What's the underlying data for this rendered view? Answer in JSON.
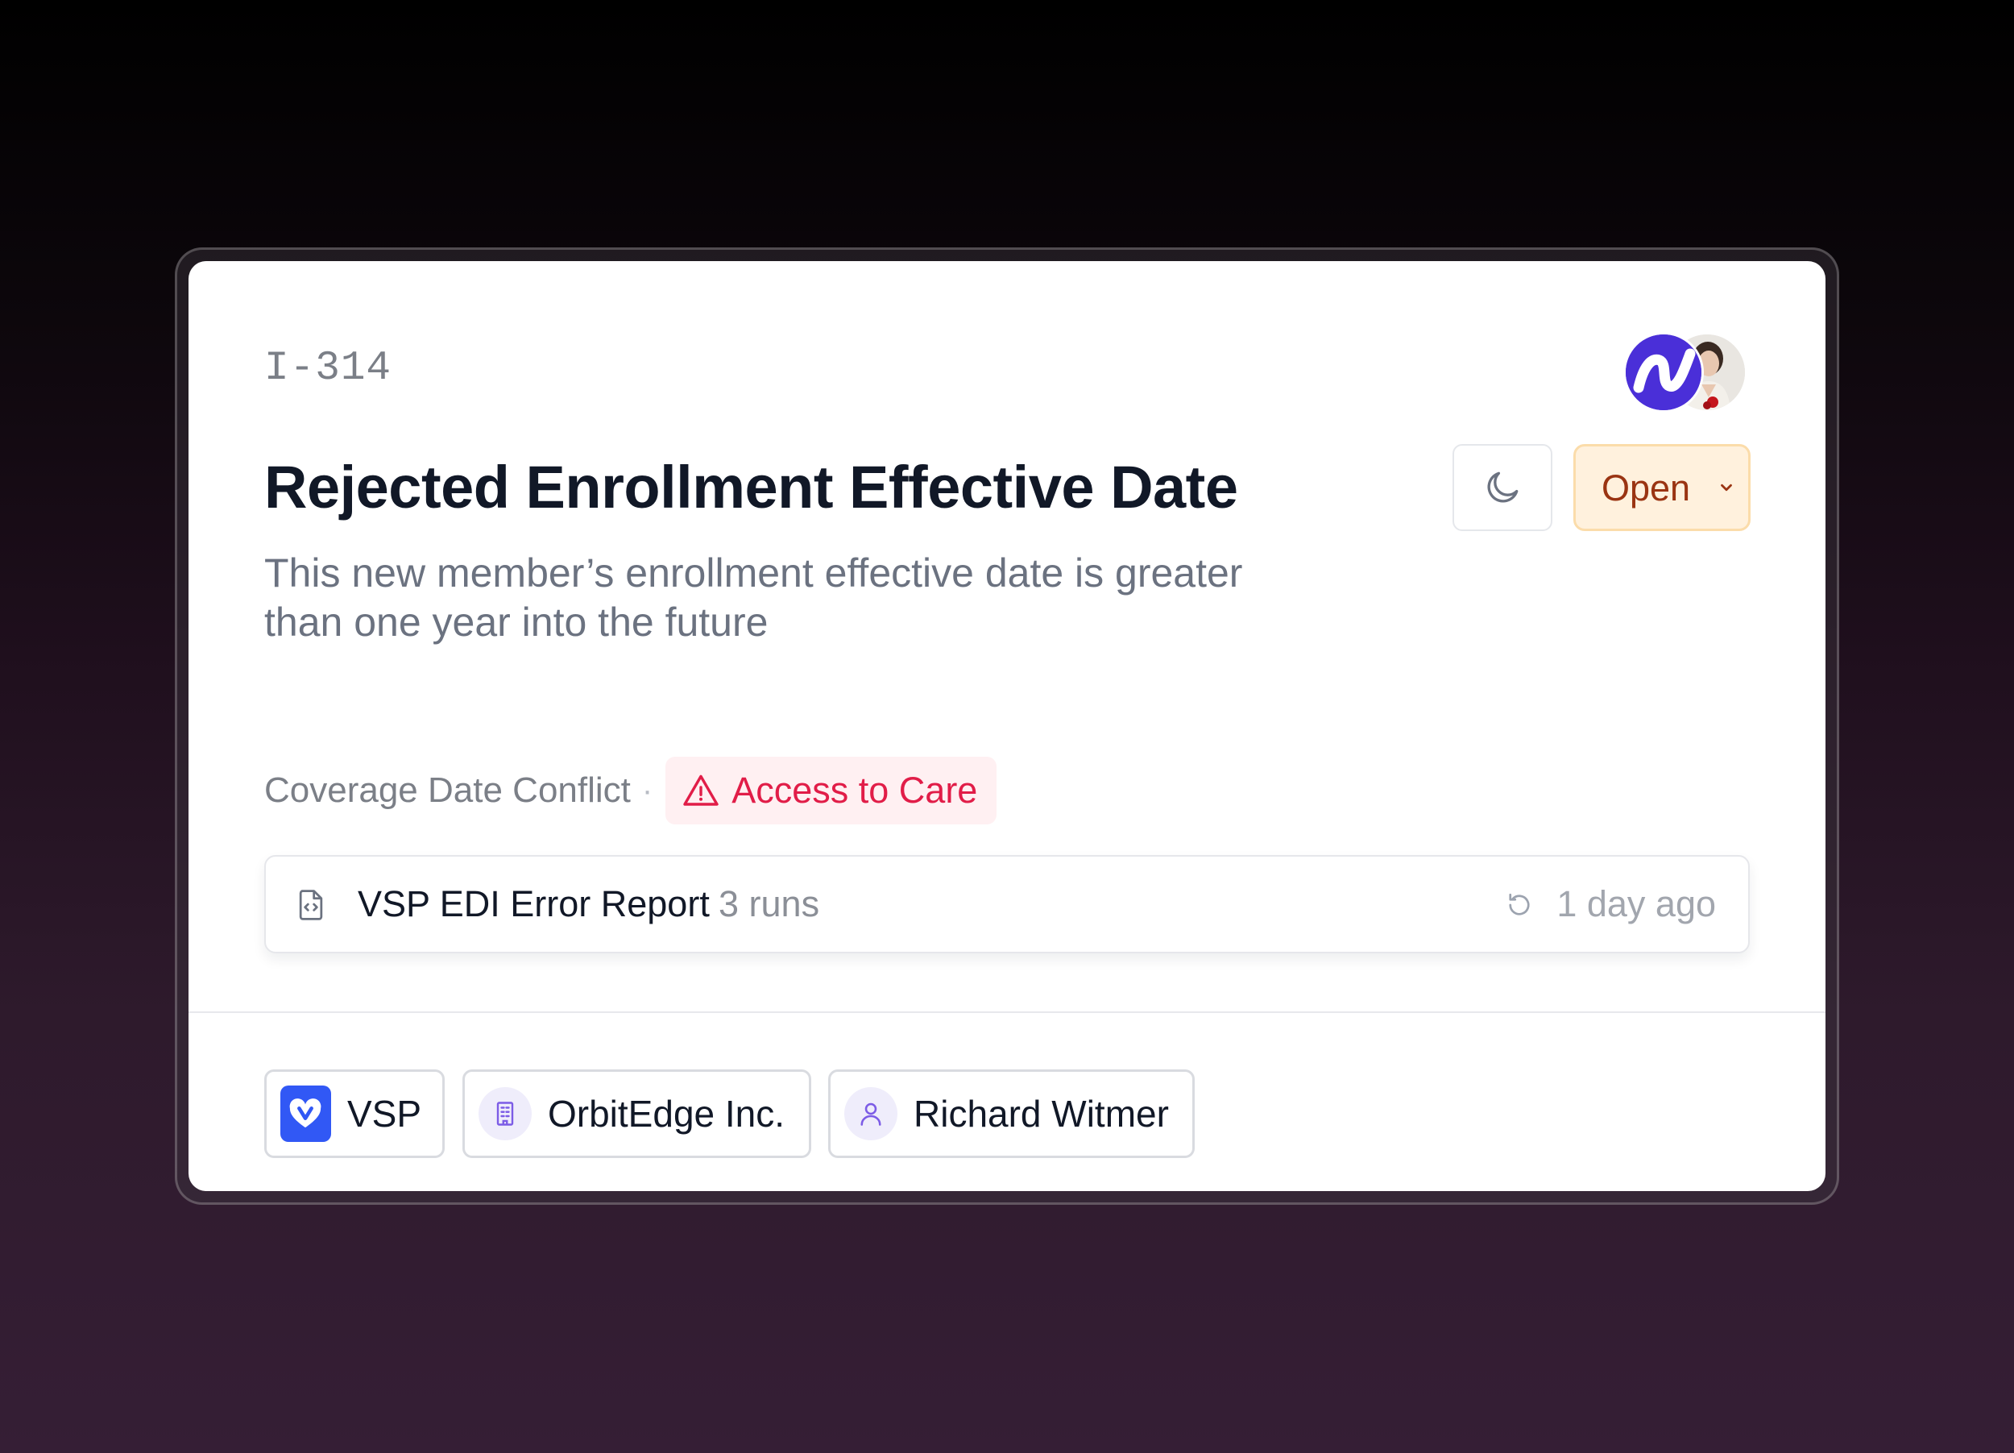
{
  "issue": {
    "id": "I-314",
    "title": "Rejected Enrollment Effective Date",
    "description": "This new member’s enrollment effective date is greater than one year into the future",
    "category": "Coverage Date Conflict",
    "separator": "·",
    "impact_badge": {
      "label": "Access to Care",
      "icon": "warning-triangle-icon",
      "color": "#e11d48"
    }
  },
  "actions": {
    "snooze_icon": "moon-icon",
    "status": {
      "selected": "Open",
      "icon": "chevron-down-icon",
      "color": "#9a3412"
    }
  },
  "assignees": [
    {
      "type": "logo",
      "icon": "brand-n-logo-icon",
      "color": "#4a2fd8"
    },
    {
      "type": "photo",
      "icon": "user-photo-avatar"
    }
  ],
  "report": {
    "icon": "file-code-icon",
    "name": "VSP EDI Error Report",
    "runs": "3 runs",
    "refresh_icon": "refresh-icon",
    "last_run": "1 day ago"
  },
  "entities": [
    {
      "label": "VSP",
      "icon": "vsp-logo-icon",
      "color": "#3158f5"
    },
    {
      "label": "OrbitEdge Inc.",
      "icon": "building-icon"
    },
    {
      "label": "Richard Witmer",
      "icon": "user-icon"
    }
  ]
}
